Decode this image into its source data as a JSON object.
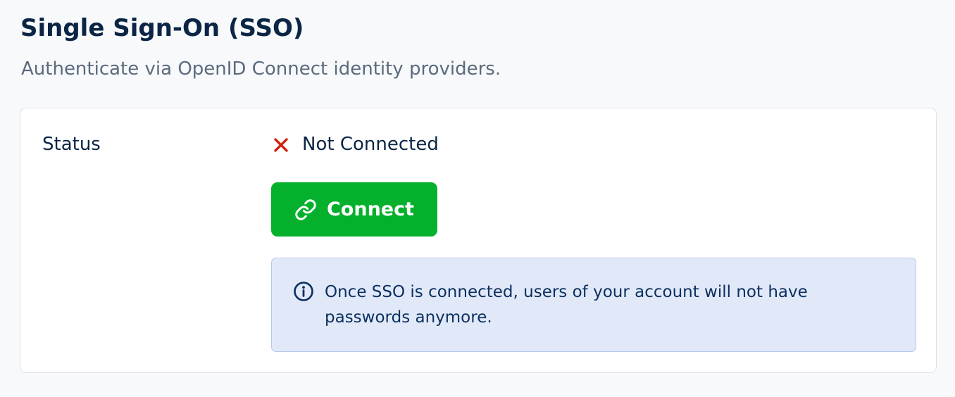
{
  "header": {
    "title": "Single Sign-On (SSO)",
    "subtitle": "Authenticate via OpenID Connect identity providers."
  },
  "status": {
    "label": "Status",
    "value": "Not Connected",
    "icon": "x-icon",
    "icon_color": "#d0210f"
  },
  "connect_button": {
    "label": "Connect",
    "icon": "link-icon",
    "color": "#05b02c"
  },
  "info_notice": {
    "icon": "info-icon",
    "text": "Once SSO is connected, users of your account will not have passwords anymore.",
    "background": "#e1e9f9"
  }
}
